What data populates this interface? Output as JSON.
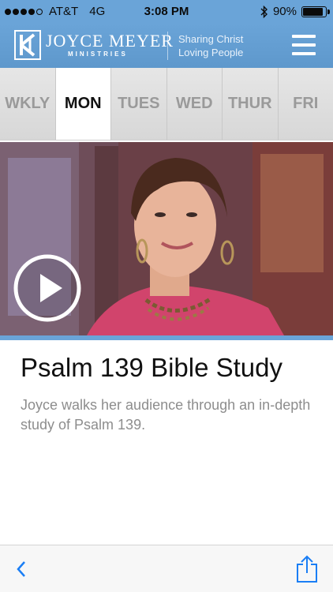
{
  "status_bar": {
    "carrier": "AT&T",
    "network": "4G",
    "time": "3:08 PM",
    "battery_percent_label": "90%",
    "battery_level": 0.9,
    "signal_bars": 4,
    "signal_bars_total": 5
  },
  "header": {
    "brand_name": "JOYCE MEYER",
    "brand_sub": "MINISTRIES",
    "tagline_line1": "Sharing Christ",
    "tagline_line2": "Loving People",
    "menu_icon": "hamburger-menu-icon"
  },
  "day_tabs": [
    {
      "label": "WKLY",
      "active": false
    },
    {
      "label": "MON",
      "active": true
    },
    {
      "label": "TUES",
      "active": false
    },
    {
      "label": "WED",
      "active": false
    },
    {
      "label": "THUR",
      "active": false
    },
    {
      "label": "FRI",
      "active": false
    }
  ],
  "video": {
    "play_icon": "play-icon"
  },
  "episode": {
    "title": "Psalm 139 Bible Study",
    "description": "Joyce walks her audience through an in-depth study of Psalm 139."
  },
  "toolbar": {
    "back_icon": "chevron-left-icon",
    "share_icon": "share-icon"
  },
  "colors": {
    "brand_blue": "#6aa4d8",
    "toolbar_blue": "#1a7ef5",
    "active_tab_text": "#111111",
    "inactive_tab_text": "#9a9a9a",
    "description_text": "#8d8d8d"
  }
}
